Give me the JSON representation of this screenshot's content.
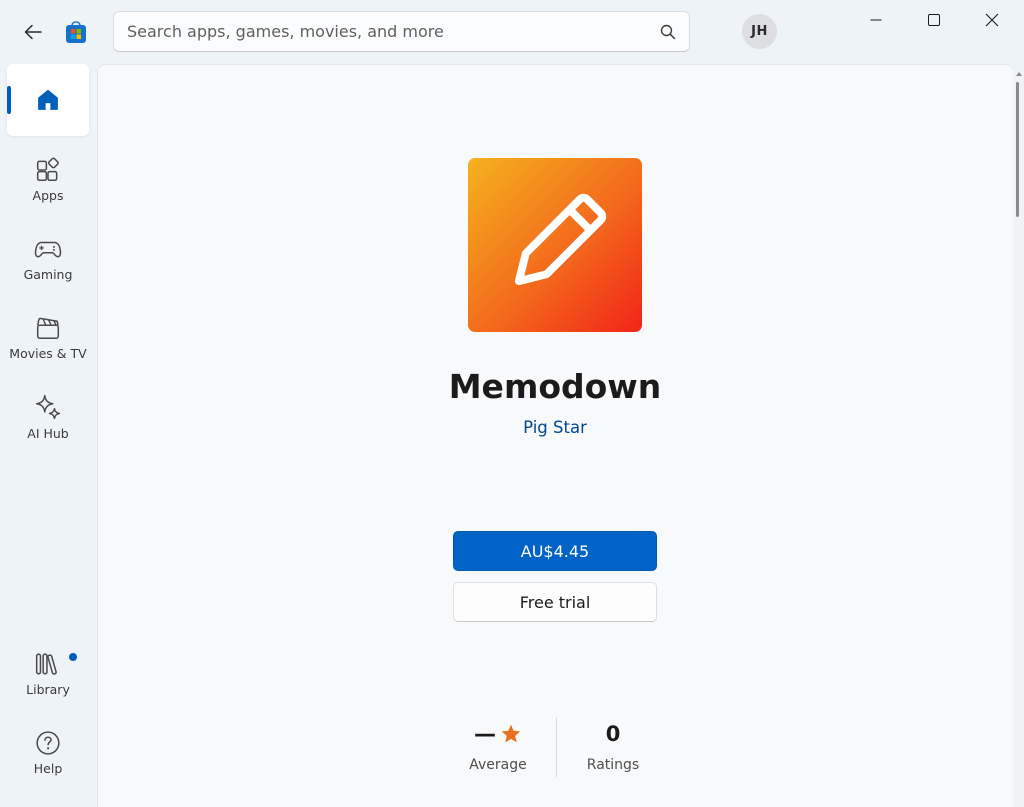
{
  "header": {
    "search_placeholder": "Search apps, games, movies, and more",
    "avatar_initials": "JH"
  },
  "sidebar": {
    "items": [
      {
        "id": "home",
        "label": "",
        "active": true
      },
      {
        "id": "apps",
        "label": "Apps"
      },
      {
        "id": "gaming",
        "label": "Gaming"
      },
      {
        "id": "movies",
        "label": "Movies & TV"
      },
      {
        "id": "ai",
        "label": "AI Hub"
      },
      {
        "id": "library",
        "label": "Library",
        "badge": true
      },
      {
        "id": "help",
        "label": "Help"
      }
    ]
  },
  "app": {
    "name": "Memodown",
    "publisher": "Pig Star",
    "price_label": "AU$4.45",
    "trial_label": "Free trial",
    "rating": {
      "average_value": "—",
      "average_label": "Average",
      "count_value": "0",
      "count_label": "Ratings"
    }
  },
  "colors": {
    "accent": "#005fb8",
    "price_button": "#0063c5",
    "publisher_link": "#00478c",
    "star": "#e8721c",
    "icon_gradient": [
      "#f4b21e",
      "#f36a1c",
      "#f22418"
    ]
  },
  "icons": {
    "back": "arrow-left-icon",
    "store": "store-bag-icon",
    "search": "search-icon",
    "minimize": "minimize-icon",
    "maximize": "maximize-icon",
    "close": "close-icon",
    "app": "pencil-icon",
    "star": "star-icon"
  }
}
